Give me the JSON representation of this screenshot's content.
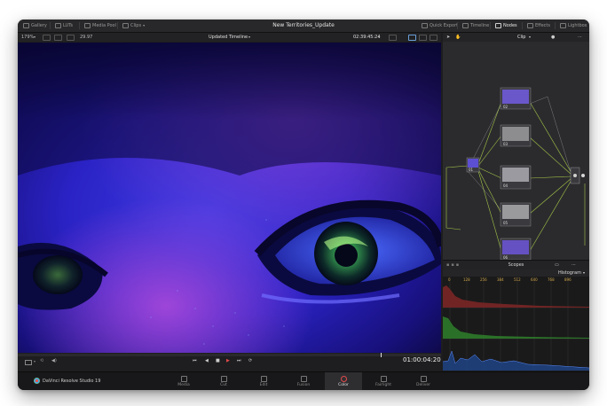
{
  "app": {
    "project_title": "New Territories_Update",
    "brand": "DaVinci Resolve Studio 19"
  },
  "topbar": {
    "left_items": [
      "Gallery",
      "LUTs",
      "Media Pool",
      "Clips"
    ],
    "right_items": [
      "Quick Export",
      "Timeline",
      "Nodes",
      "Effects",
      "Lightbox"
    ]
  },
  "viewer_bar": {
    "zoom": "179%",
    "fps": "29.97",
    "timeline_name": "Updated Timeline",
    "timecode": "02:39:45:24",
    "panel_mode": "Clip"
  },
  "nodes": [
    {
      "id": "01",
      "label": "01",
      "color": "#5d4fd1"
    },
    {
      "id": "02",
      "label": "02",
      "color": "#6a57c9"
    },
    {
      "id": "03",
      "label": "03",
      "color": "#8d8d90"
    },
    {
      "id": "04",
      "label": "04",
      "color": "#9a9aa0"
    },
    {
      "id": "05",
      "label": "05",
      "color": "#9a9a9c"
    },
    {
      "id": "06",
      "label": "06",
      "color": "#6551c2"
    }
  ],
  "scopes": {
    "title": "Scopes",
    "mode": "Histogram",
    "ticks": [
      "0",
      "128",
      "256",
      "384",
      "512",
      "640",
      "768",
      "896"
    ]
  },
  "transport": {
    "timecode": "01:00:04:20"
  },
  "pages": [
    {
      "label": "Media",
      "active": false
    },
    {
      "label": "Cut",
      "active": false
    },
    {
      "label": "Edit",
      "active": false
    },
    {
      "label": "Fusion",
      "active": false
    },
    {
      "label": "Color",
      "active": true
    },
    {
      "label": "Fairlight",
      "active": false
    },
    {
      "label": "Deliver",
      "active": false
    }
  ],
  "colors": {
    "accent_red": "#e24b4b",
    "node_link": "#b9e04a",
    "viewer_blue": "#2a22b8"
  }
}
